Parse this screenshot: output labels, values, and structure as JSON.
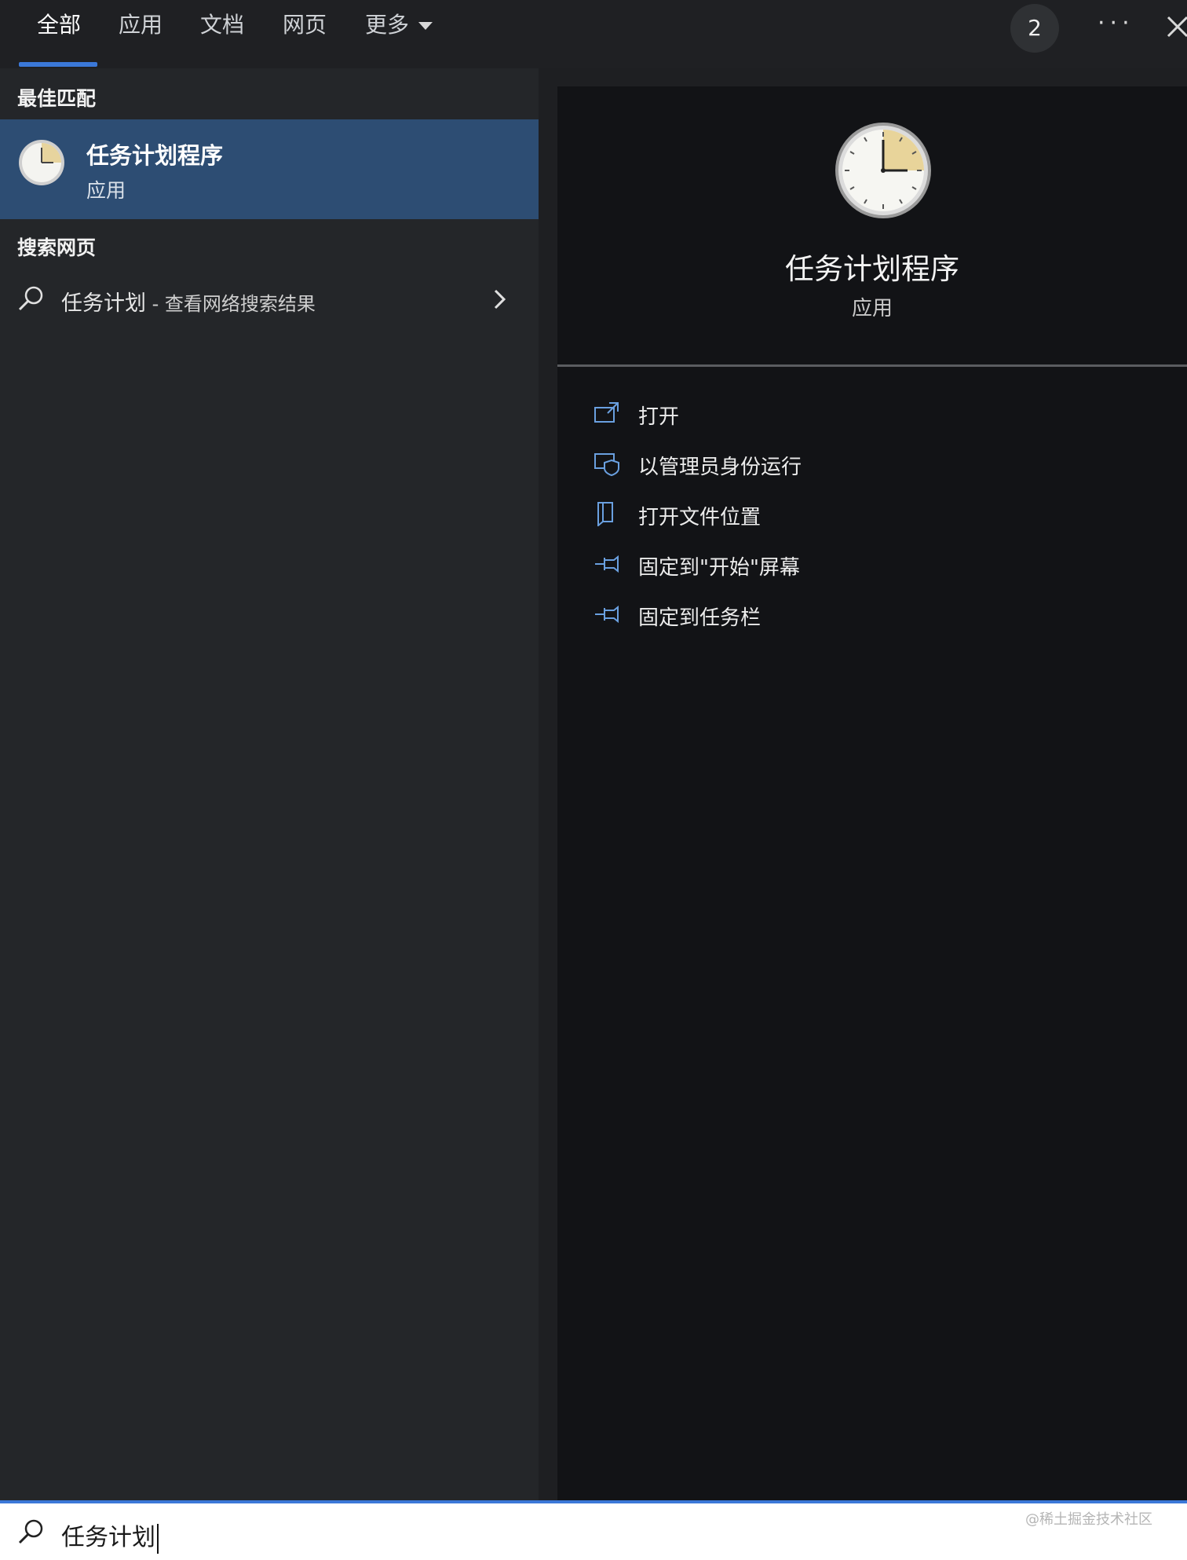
{
  "tabs": [
    {
      "label": "全部"
    },
    {
      "label": "应用"
    },
    {
      "label": "文档"
    },
    {
      "label": "网页"
    },
    {
      "label": "更多"
    }
  ],
  "header": {
    "badge_count": "2",
    "more_dots": "···"
  },
  "best_match": {
    "section_label": "最佳匹配",
    "title": "任务计划程序",
    "subtitle": "应用"
  },
  "web": {
    "section_label": "搜索网页",
    "query": "任务计划",
    "suffix": " - 查看网络搜索结果"
  },
  "detail": {
    "title": "任务计划程序",
    "subtitle": "应用",
    "actions": [
      {
        "label": "打开",
        "icon": "open-icon"
      },
      {
        "label": "以管理员身份运行",
        "icon": "run-as-admin-icon"
      },
      {
        "label": "打开文件位置",
        "icon": "file-location-icon"
      },
      {
        "label": "固定到\"开始\"屏幕",
        "icon": "pin-start-icon"
      },
      {
        "label": "固定到任务栏",
        "icon": "pin-taskbar-icon"
      }
    ]
  },
  "search": {
    "value": "任务计划"
  },
  "watermark": "@稀土掘金技术社区",
  "colors": {
    "accent": "#3b78d8",
    "selected_bg": "#2d4d73",
    "left_bg": "#242629",
    "right_bg": "#121316"
  }
}
